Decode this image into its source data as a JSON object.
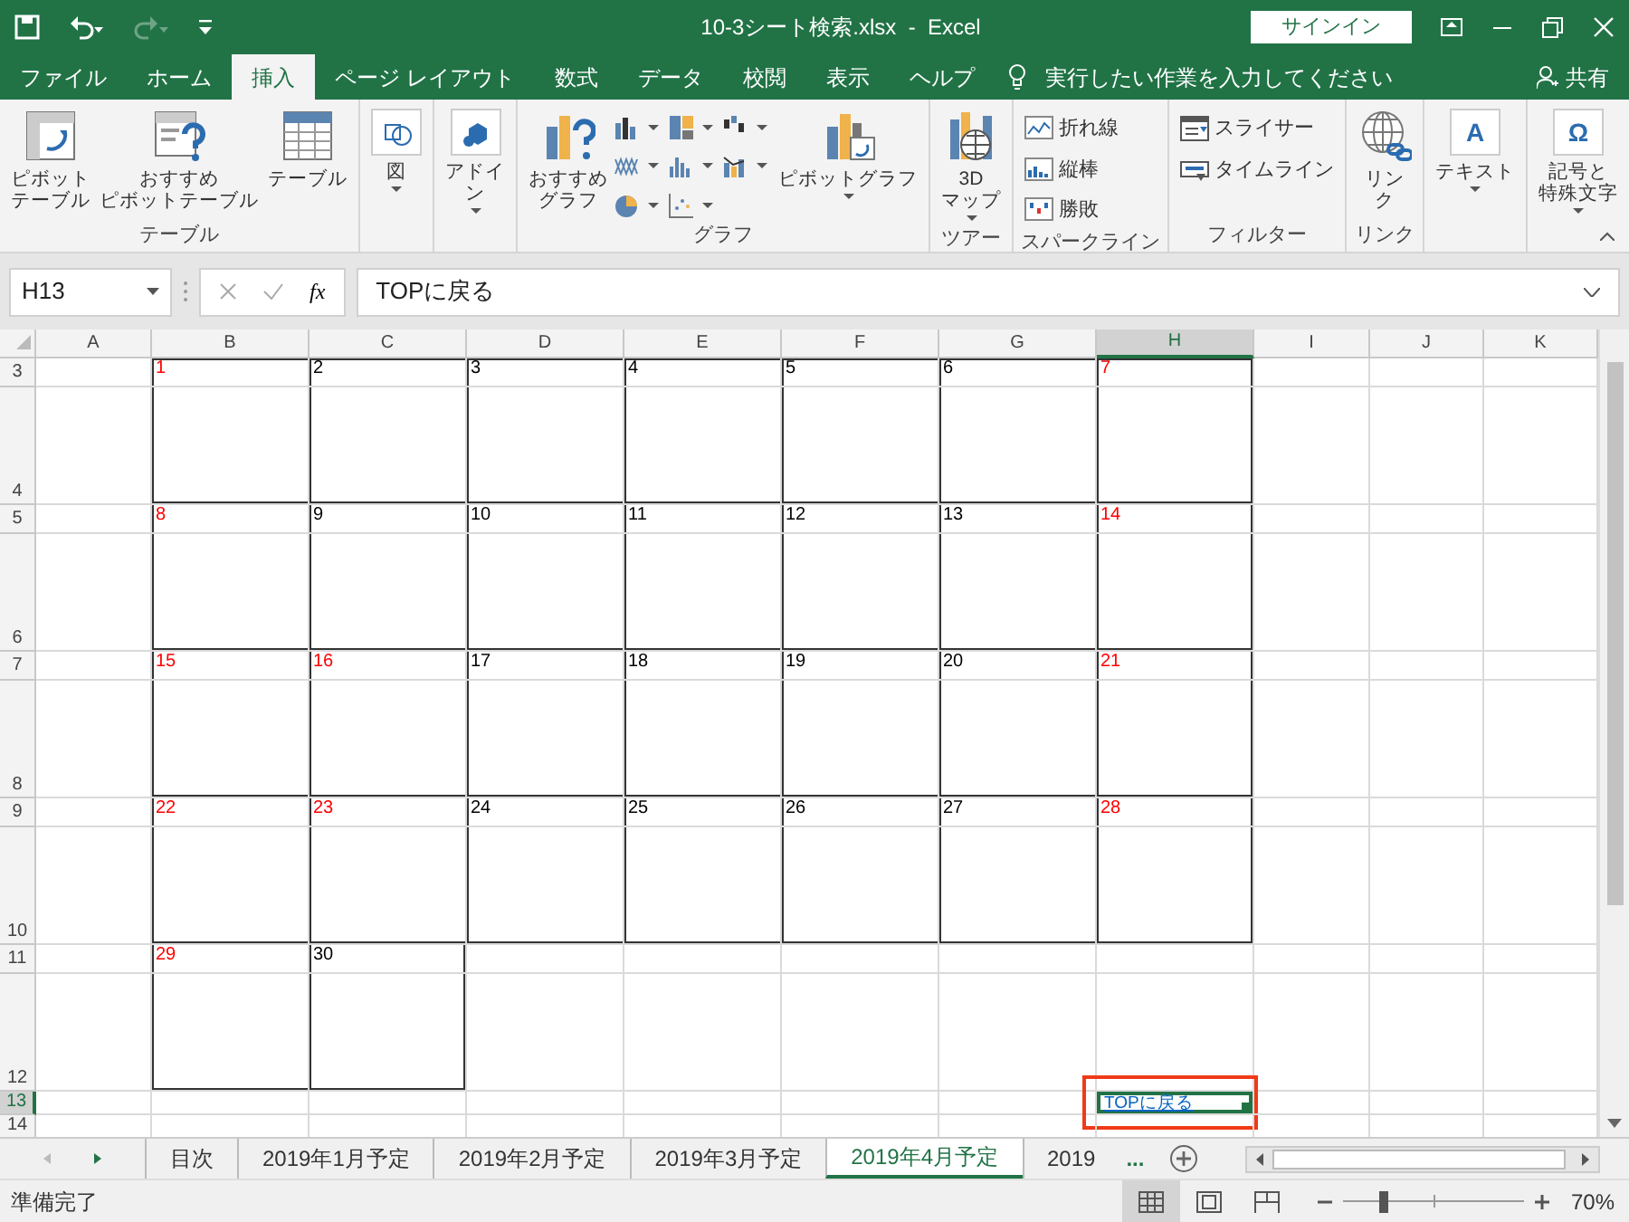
{
  "window": {
    "title": "10-3シート検索.xlsx  -  Excel",
    "sign_in": "サインイン"
  },
  "ribbon_tabs": [
    {
      "label": "ファイル",
      "selected": false
    },
    {
      "label": "ホーム",
      "selected": false
    },
    {
      "label": "挿入",
      "selected": true
    },
    {
      "label": "ページ レイアウト",
      "selected": false
    },
    {
      "label": "数式",
      "selected": false
    },
    {
      "label": "データ",
      "selected": false
    },
    {
      "label": "校閲",
      "selected": false
    },
    {
      "label": "表示",
      "selected": false
    },
    {
      "label": "ヘルプ",
      "selected": false
    }
  ],
  "tell_me": {
    "placeholder": "実行したい作業を入力してください"
  },
  "share": "共有",
  "ribbon_groups": [
    {
      "label": "テーブル",
      "buttons": [
        {
          "kind": "large",
          "lines": [
            "ピボット",
            "テーブル"
          ],
          "dropdown": false
        },
        {
          "kind": "large",
          "lines": [
            "おすすめ",
            "ピボットテーブル"
          ],
          "dropdown": false
        },
        {
          "kind": "large",
          "lines": [
            "テーブル"
          ],
          "dropdown": false
        }
      ]
    },
    {
      "buttons": [
        {
          "kind": "boxed",
          "lines": [
            "図"
          ],
          "dropdown": true
        }
      ]
    },
    {
      "buttons": [
        {
          "kind": "boxed",
          "lines": [
            "アドイ",
            "ン"
          ],
          "dropdown": true
        }
      ]
    },
    {
      "label": "グラフ",
      "buttons": [
        {
          "kind": "large",
          "lines": [
            "おすすめ",
            "グラフ"
          ],
          "dropdown": false
        },
        {
          "kind": "gallery"
        },
        {
          "kind": "large",
          "lines": [
            "ピボットグラフ"
          ],
          "dropdown": true
        }
      ]
    },
    {
      "label": "ツアー",
      "buttons": [
        {
          "kind": "large",
          "lines": [
            "3D",
            "マップ"
          ],
          "dropdown": true
        }
      ]
    },
    {
      "label": "スパークライン",
      "buttons": [
        {
          "kind": "small",
          "label": "折れ線"
        },
        {
          "kind": "small",
          "label": "縦棒"
        },
        {
          "kind": "small",
          "label": "勝敗"
        }
      ]
    },
    {
      "label": "フィルター",
      "buttons": [
        {
          "kind": "small",
          "label": "スライサー"
        },
        {
          "kind": "small",
          "label": "タイムライン"
        }
      ]
    },
    {
      "label": "リンク",
      "buttons": [
        {
          "kind": "large",
          "lines": [
            "リン",
            "ク"
          ],
          "dropdown": false
        }
      ]
    },
    {
      "buttons": [
        {
          "kind": "boxed",
          "glyph": "A",
          "lines": [
            "テキスト"
          ],
          "dropdown": true
        }
      ]
    },
    {
      "buttons": [
        {
          "kind": "boxed",
          "glyph": "Ω",
          "lines": [
            "記号と",
            "特殊文字"
          ],
          "dropdown": true
        }
      ]
    }
  ],
  "name_box": {
    "value": "H13"
  },
  "formula_bar": {
    "function_label": "fx",
    "value": "TOPに戻る"
  },
  "columns": [
    {
      "label": "A",
      "selected": false
    },
    {
      "label": "B",
      "selected": false
    },
    {
      "label": "C",
      "selected": false
    },
    {
      "label": "D",
      "selected": false
    },
    {
      "label": "E",
      "selected": false
    },
    {
      "label": "F",
      "selected": false
    },
    {
      "label": "G",
      "selected": false
    },
    {
      "label": "H",
      "selected": true
    },
    {
      "label": "I",
      "selected": false
    },
    {
      "label": "J",
      "selected": false
    },
    {
      "label": "K",
      "selected": false
    }
  ],
  "rows": [
    {
      "label": "3",
      "selected": false,
      "days": [
        {
          "day": "1",
          "color": "#ff0000"
        },
        {
          "day": "2",
          "color": "#000000"
        },
        {
          "day": "3",
          "color": "#000000"
        },
        {
          "day": "4",
          "color": "#000000"
        },
        {
          "day": "5",
          "color": "#000000"
        },
        {
          "day": "6",
          "color": "#000000"
        },
        {
          "day": "7",
          "color": "#ff0000"
        }
      ]
    },
    {
      "label": "4",
      "selected": false
    },
    {
      "label": "5",
      "selected": false,
      "days": [
        {
          "day": "8",
          "color": "#ff0000"
        },
        {
          "day": "9",
          "color": "#000000"
        },
        {
          "day": "10",
          "color": "#000000"
        },
        {
          "day": "11",
          "color": "#000000"
        },
        {
          "day": "12",
          "color": "#000000"
        },
        {
          "day": "13",
          "color": "#000000"
        },
        {
          "day": "14",
          "color": "#ff0000"
        }
      ]
    },
    {
      "label": "6",
      "selected": false
    },
    {
      "label": "7",
      "selected": false,
      "days": [
        {
          "day": "15",
          "color": "#ff0000"
        },
        {
          "day": "16",
          "color": "#ff0000"
        },
        {
          "day": "17",
          "color": "#000000"
        },
        {
          "day": "18",
          "color": "#000000"
        },
        {
          "day": "19",
          "color": "#000000"
        },
        {
          "day": "20",
          "color": "#000000"
        },
        {
          "day": "21",
          "color": "#ff0000"
        }
      ]
    },
    {
      "label": "8",
      "selected": false
    },
    {
      "label": "9",
      "selected": false,
      "days": [
        {
          "day": "22",
          "color": "#ff0000"
        },
        {
          "day": "23",
          "color": "#ff0000"
        },
        {
          "day": "24",
          "color": "#000000"
        },
        {
          "day": "25",
          "color": "#000000"
        },
        {
          "day": "26",
          "color": "#000000"
        },
        {
          "day": "27",
          "color": "#000000"
        },
        {
          "day": "28",
          "color": "#ff0000"
        }
      ]
    },
    {
      "label": "10",
      "selected": false
    },
    {
      "label": "11",
      "selected": false,
      "days": [
        {
          "day": "29",
          "color": "#ff0000"
        },
        {
          "day": "30",
          "color": "#000000"
        }
      ]
    },
    {
      "label": "12",
      "selected": false
    },
    {
      "label": "13",
      "selected": true,
      "link": {
        "text": "TOPに戻る"
      }
    },
    {
      "label": "14",
      "selected": false
    }
  ],
  "sheet_tabs": [
    {
      "label": "目次",
      "selected": false
    },
    {
      "label": "2019年1月予定",
      "selected": false
    },
    {
      "label": "2019年2月予定",
      "selected": false
    },
    {
      "label": "2019年3月予定",
      "selected": false
    },
    {
      "label": "2019年4月予定",
      "selected": true
    },
    {
      "label": "2019",
      "selected": false
    }
  ],
  "more_sheets": "...",
  "status_bar": {
    "text": "準備完了",
    "views": [
      {
        "selected": true
      },
      {
        "selected": false
      },
      {
        "selected": false
      }
    ],
    "zoom": {
      "level": 0.22,
      "reading": "70%"
    }
  }
}
